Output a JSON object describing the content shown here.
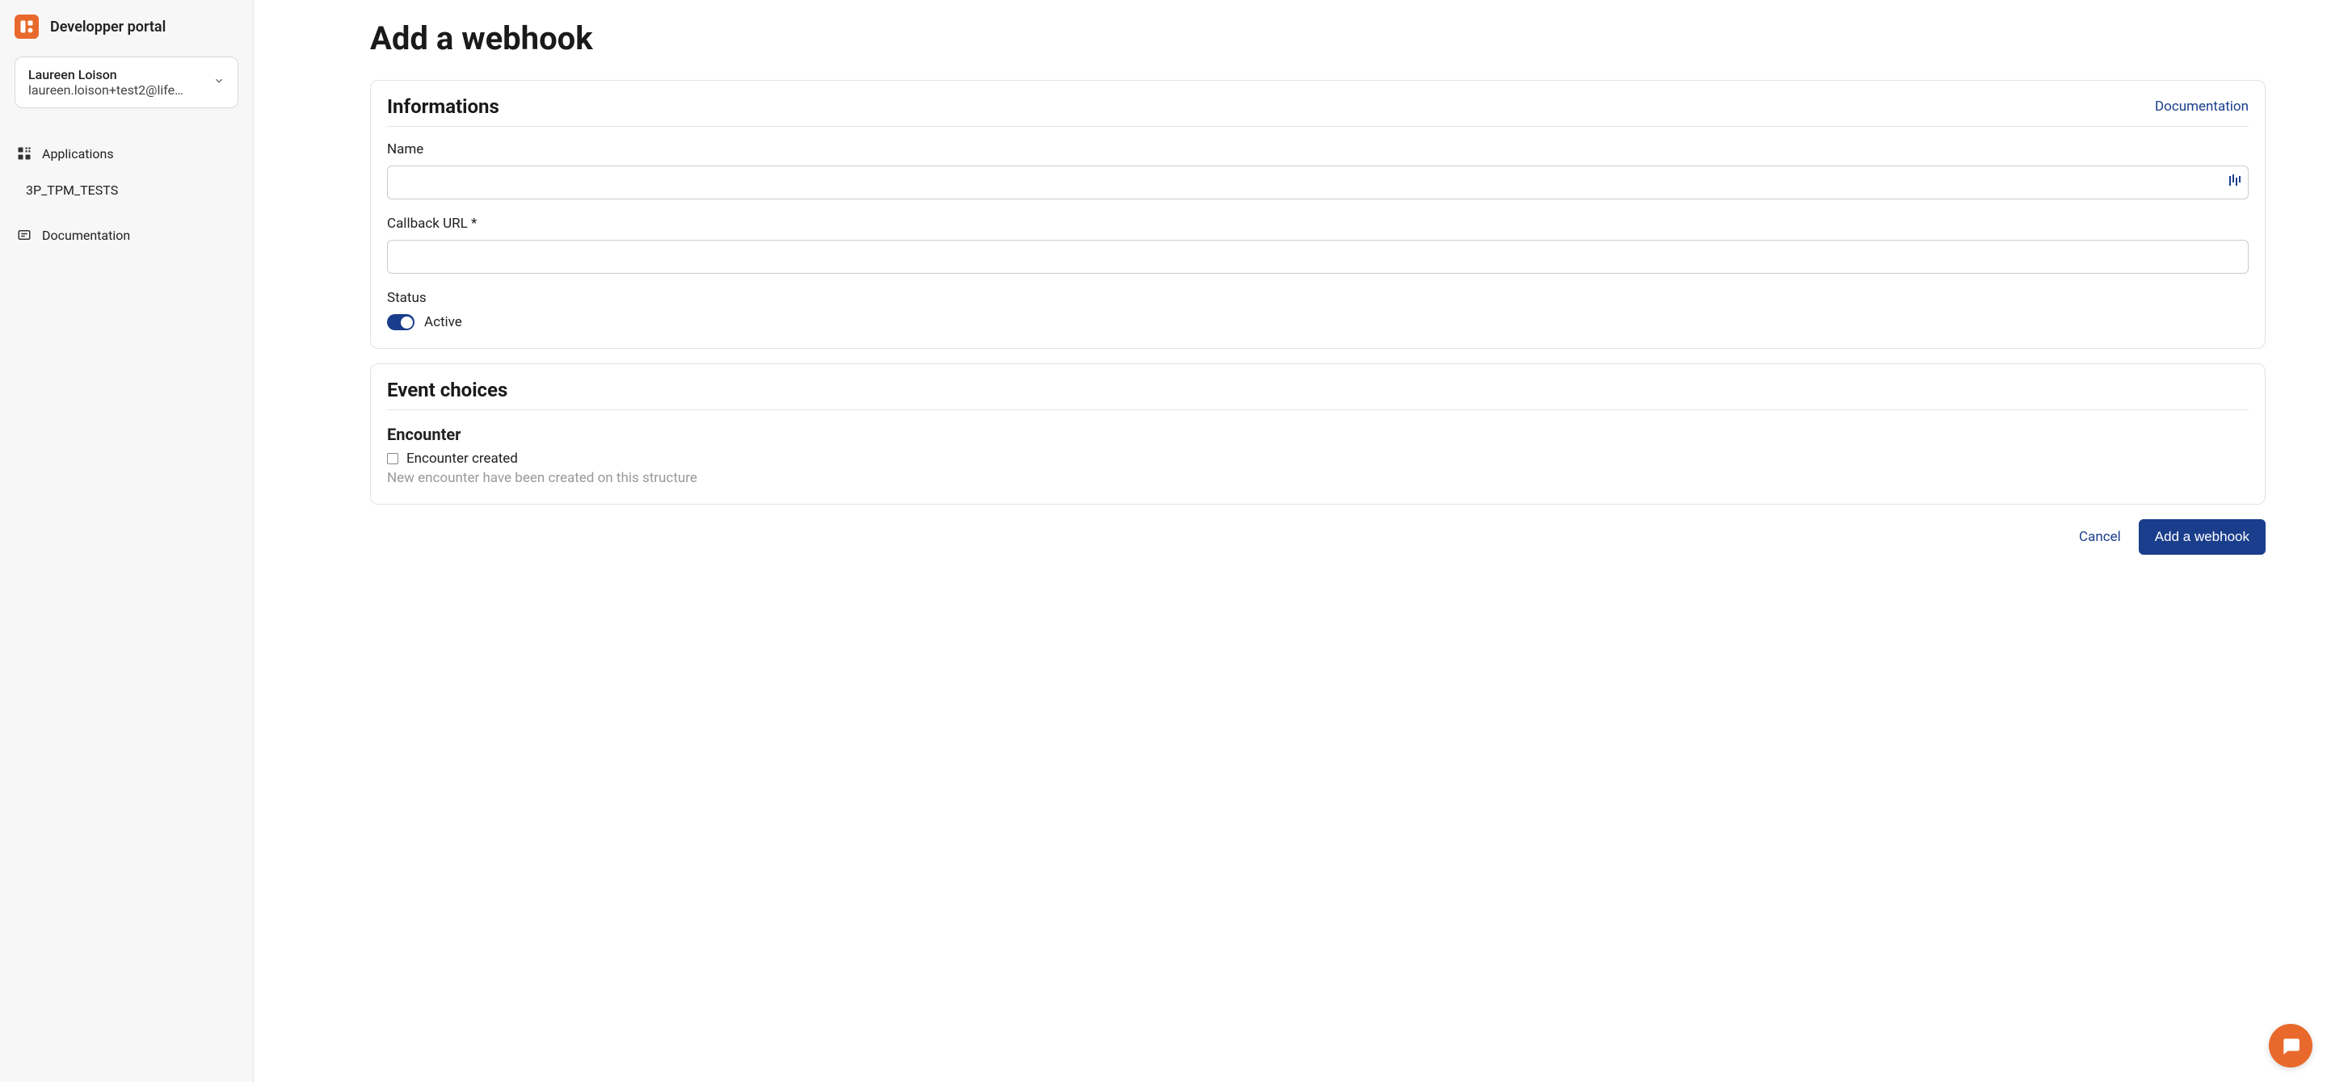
{
  "sidebar": {
    "brand_title": "Developper portal",
    "account": {
      "name": "Laureen Loison",
      "email": "laureen.loison+test2@life…"
    },
    "nav": {
      "applications_label": "Applications",
      "application_sub": "3P_TPM_TESTS",
      "documentation_label": "Documentation"
    }
  },
  "main": {
    "page_title": "Add a webhook",
    "info_card": {
      "title": "Informations",
      "doc_link": "Documentation",
      "name_label": "Name",
      "name_value": "",
      "callback_label": "Callback URL *",
      "callback_value": "",
      "status_label": "Status",
      "status_toggle_label": "Active",
      "status_active": true
    },
    "events_card": {
      "title": "Event choices",
      "group_title": "Encounter",
      "event_label": "Encounter created",
      "event_desc": "New encounter have been created on this structure",
      "event_checked": false
    },
    "actions": {
      "cancel": "Cancel",
      "submit": "Add a webhook"
    }
  }
}
